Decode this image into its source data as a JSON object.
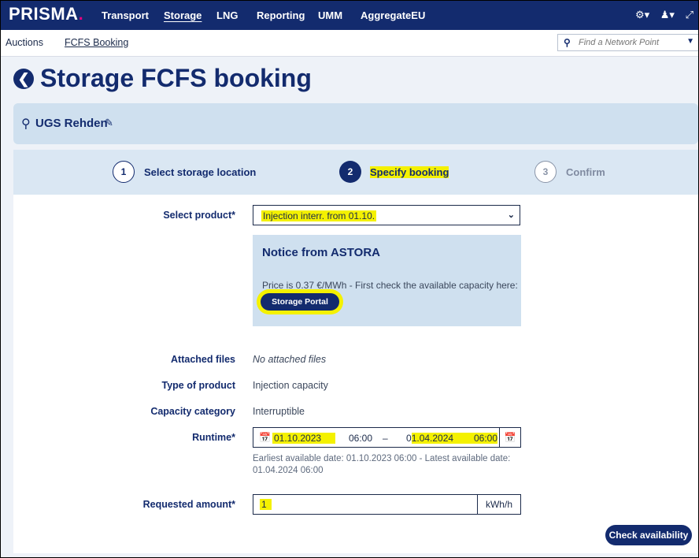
{
  "nav": {
    "logo": "PRISMA",
    "items": [
      "Transport",
      "Storage",
      "LNG",
      "Reporting",
      "UMM",
      "AggregateEU"
    ],
    "active_item": "Storage",
    "icons": [
      "gear-icon",
      "user-icon",
      "expand-icon"
    ]
  },
  "subnav": {
    "links": [
      "Auctions",
      "FCFS Booking"
    ],
    "search_placeholder": "Find a Network Point"
  },
  "page": {
    "title": "Storage FCFS booking",
    "location": "UGS Rehden"
  },
  "steps": [
    {
      "number": "1",
      "label": "Select storage location",
      "state": "done"
    },
    {
      "number": "2",
      "label": "Specify booking",
      "state": "active"
    },
    {
      "number": "3",
      "label": "Confirm",
      "state": "todo"
    }
  ],
  "form": {
    "product_label": "Select product*",
    "product_value": "Injection interr. from 01.10.",
    "notice_title": "Notice from ASTORA",
    "notice_text": "Price is 0.37 €/MWh - First check the available capacity here:",
    "portal_button": "Storage Portal",
    "files_label": "Attached files",
    "files_value": "No attached files",
    "type_label": "Type of product",
    "type_value": "Injection capacity",
    "category_label": "Capacity category",
    "category_value": "Interruptible",
    "runtime_label": "Runtime*",
    "runtime_start_date": "01.10.2023",
    "runtime_start_time": "06:00",
    "runtime_separator": "–",
    "runtime_end_date": "01.04.2024",
    "runtime_end_time": "06:00",
    "runtime_hint": "Earliest available date: 01.10.2023 06:00 - Latest available date: 01.04.2024 06:00",
    "amount_label": "Requested amount*",
    "amount_value": "1",
    "amount_unit": "kWh/h",
    "check_button": "Check availability"
  },
  "colors": {
    "brand_navy": "#132b6e",
    "accent_pink": "#e6007e",
    "highlight": "#f4f100",
    "panel_blue": "#cfe0ef"
  }
}
